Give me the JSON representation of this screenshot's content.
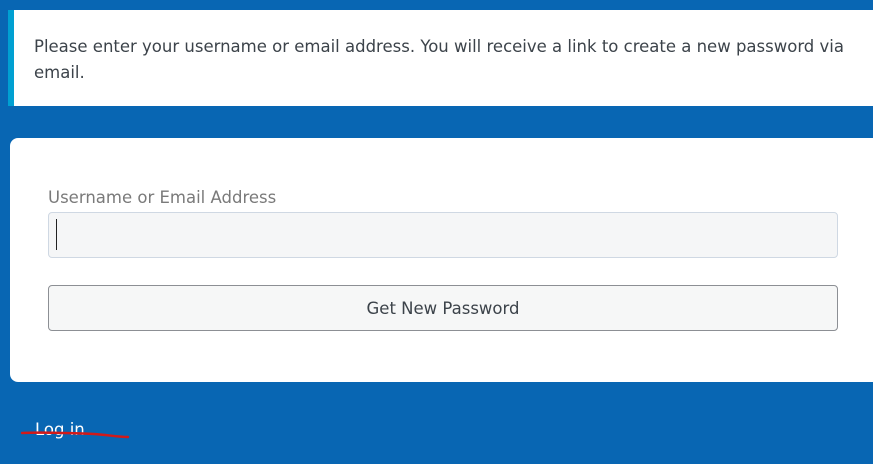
{
  "message": {
    "text": "Please enter your username or email address. You will receive a link to create a new password via email."
  },
  "form": {
    "username_label": "Username or Email Address",
    "username_value": "",
    "submit_label": "Get New Password"
  },
  "footer": {
    "login_link": "Log in"
  },
  "colors": {
    "background": "#0866b3",
    "message_accent": "#00a0d2",
    "annotation_stroke": "#d11a1a"
  }
}
